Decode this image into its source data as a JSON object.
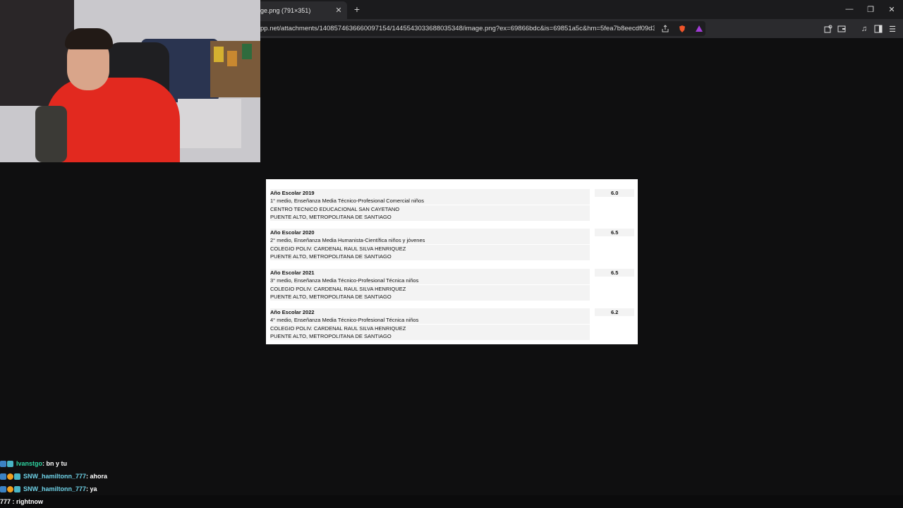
{
  "browser": {
    "tab_title": "ge.png (791×351)",
    "url": "pp.net/attachments/1408574636660097154/1445543033688035348/image.png?ex=69866bdc&is=69851a5c&hm=5fea7b8eecdf09d3…",
    "window_controls": {
      "minimize": "—",
      "restore": "❐",
      "close": "✕"
    }
  },
  "document": {
    "records": [
      {
        "year": "Año Escolar 2019",
        "grade": "6.0",
        "level": "1° medio, Enseñanza Media Técnico-Profesional Comercial niños",
        "school": "CENTRO TECNICO EDUCACIONAL SAN CAYETANO",
        "location": "PUENTE ALTO, METROPOLITANA DE SANTIAGO"
      },
      {
        "year": "Año Escolar 2020",
        "grade": "6.5",
        "level": "2° medio, Enseñanza Media Humanista-Científica niños y jóvenes",
        "school": "COLEGIO POLIV. CARDENAL RAUL SILVA HENRIQUEZ",
        "location": "PUENTE ALTO, METROPOLITANA DE SANTIAGO"
      },
      {
        "year": "Año Escolar 2021",
        "grade": "6.5",
        "level": "3° medio, Enseñanza Media Técnico-Profesional Técnica niños",
        "school": "COLEGIO POLIV. CARDENAL RAUL SILVA HENRIQUEZ",
        "location": "PUENTE ALTO, METROPOLITANA DE SANTIAGO"
      },
      {
        "year": "Año Escolar 2022",
        "grade": "6.2",
        "level": "4° medio, Enseñanza Media Técnico-Profesional Técnica niños",
        "school": "COLEGIO POLIV. CARDENAL RAUL SILVA HENRIQUEZ",
        "location": "PUENTE ALTO, METROPOLITANA DE SANTIAGO"
      }
    ]
  },
  "chat": {
    "messages": [
      {
        "user": "Ivanstgo",
        "message": ": bn y tu"
      },
      {
        "user": "SNW_hamiltonn_777",
        "message": ": ahora"
      },
      {
        "user": "SNW_hamiltonn_777",
        "message": ": ya"
      }
    ],
    "partial": "777 : rightnow"
  },
  "colors": {
    "accent_chat_user1": "#2ed4a0",
    "accent_chat_user2": "#6fd3e8",
    "page_bg": "#0f0f10"
  }
}
